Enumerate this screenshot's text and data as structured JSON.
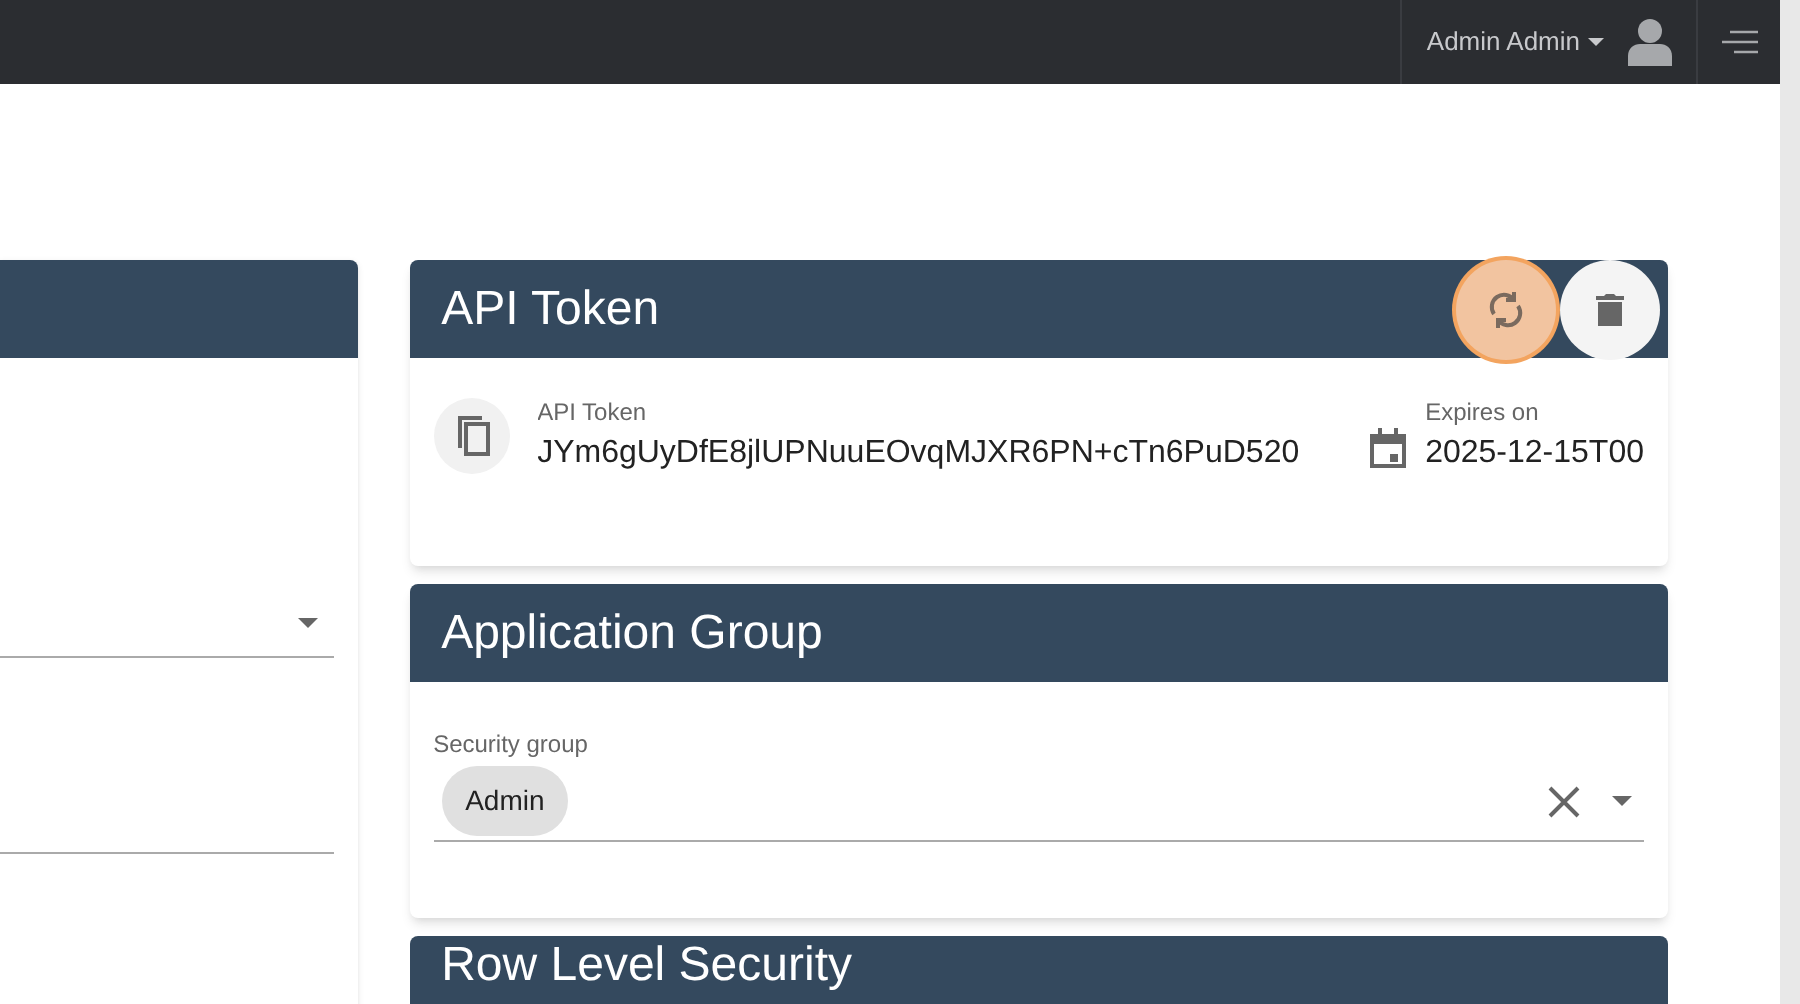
{
  "top_bar": {
    "user_name": "Admin Admin"
  },
  "api_token_card": {
    "title": "API Token",
    "actions": [
      {
        "kind": "refresh",
        "highlighted": true
      },
      {
        "kind": "delete",
        "highlighted": false
      }
    ],
    "token": {
      "label": "API Token",
      "value": "JYm6gUyDfE8jlUPNuuEOvqMJXR6PN+cTn6PuD520"
    },
    "expires": {
      "label": "Expires on",
      "value": "2025-12-15T00"
    }
  },
  "application_group_card": {
    "title": "Application Group",
    "security_group": {
      "label": "Security group",
      "chips": [
        "Admin"
      ]
    }
  },
  "row_level_security_card": {
    "title": "Row Level Security"
  }
}
